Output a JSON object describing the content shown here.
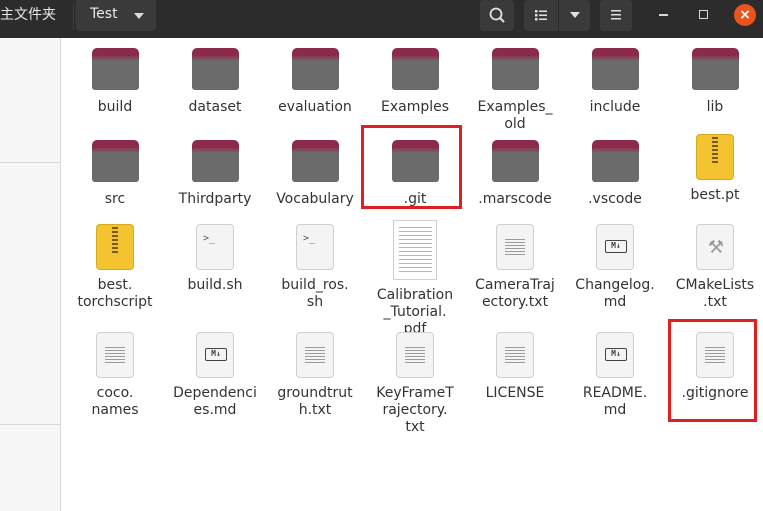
{
  "header": {
    "breadcrumb_home": "主文件夹",
    "breadcrumb_current": "Test",
    "search_icon": "search-icon",
    "view_icon": "list-view-icon",
    "menu_icon": "hamburger-menu-icon",
    "close_symbol": "×"
  },
  "items": [
    {
      "name": "build",
      "type": "folder"
    },
    {
      "name": "dataset",
      "type": "folder"
    },
    {
      "name": "evaluation",
      "type": "folder"
    },
    {
      "name": "Examples",
      "type": "folder"
    },
    {
      "name": "Examples_\nold",
      "type": "folder"
    },
    {
      "name": "include",
      "type": "folder"
    },
    {
      "name": "lib",
      "type": "folder"
    },
    {
      "name": "src",
      "type": "folder"
    },
    {
      "name": "Thirdparty",
      "type": "folder"
    },
    {
      "name": "Vocabulary",
      "type": "folder"
    },
    {
      "name": ".git",
      "type": "folder"
    },
    {
      "name": ".marscode",
      "type": "folder"
    },
    {
      "name": ".vscode",
      "type": "folder"
    },
    {
      "name": "best.pt",
      "type": "zip"
    },
    {
      "name": "best.\ntorchscript",
      "type": "zip"
    },
    {
      "name": "build.sh",
      "type": "script"
    },
    {
      "name": "build_ros.\nsh",
      "type": "script"
    },
    {
      "name": "Calibration\n_Tutorial.\npdf",
      "type": "pdf"
    },
    {
      "name": "CameraTraj\nectory.txt",
      "type": "text"
    },
    {
      "name": "Changelog.\nmd",
      "type": "markdown"
    },
    {
      "name": "CMakeLists\n.txt",
      "type": "cmake"
    },
    {
      "name": "coco.\nnames",
      "type": "text"
    },
    {
      "name": "Dependenci\nes.md",
      "type": "markdown"
    },
    {
      "name": "groundtrut\nh.txt",
      "type": "text"
    },
    {
      "name": "KeyFrameT\nrajectory.\ntxt",
      "type": "text"
    },
    {
      "name": "LICENSE",
      "type": "text"
    },
    {
      "name": "README.\nmd",
      "type": "markdown"
    },
    {
      "name": ".gitignore",
      "type": "text"
    }
  ],
  "highlighted_items": [
    ".git",
    ".gitignore"
  ],
  "colors": {
    "header_bg": "#2c2c2c",
    "folder_tab": "#8c2a4a",
    "folder_body": "#6b6b6b",
    "highlight": "#e02020",
    "close_button": "#e9541f"
  }
}
